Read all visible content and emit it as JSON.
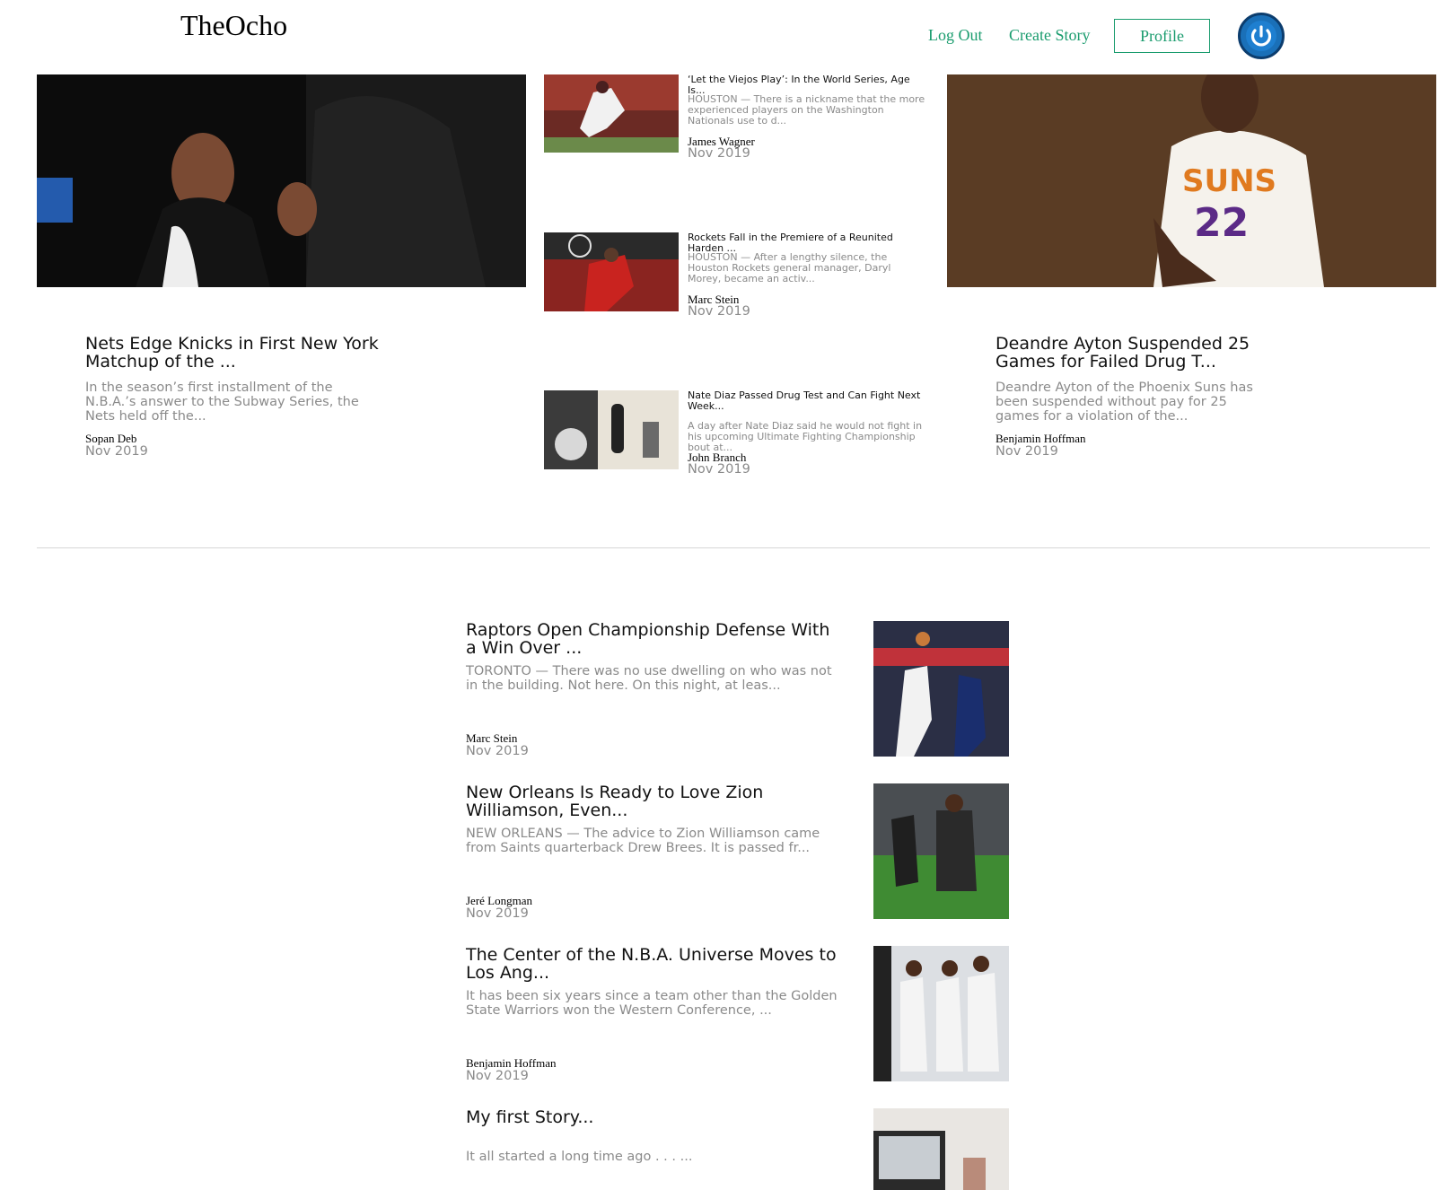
{
  "header": {
    "brand": "TheOcho",
    "logout": "Log Out",
    "create_story": "Create Story",
    "profile": "Profile",
    "accent_color": "#1a9c6e"
  },
  "featured": [
    {
      "title": "Nets Edge Knicks in First New York Matchup of the ...",
      "description": "In the season’s first installment of the N.B.A.’s answer to the Subway Series, the Nets held off the...",
      "author": "Sopan Deb",
      "date": "Nov 2019"
    },
    {
      "title": "Deandre Ayton Suspended 25 Games for Failed Drug T...",
      "description": "Deandre Ayton of the Phoenix Suns has been suspended without pay for 25 games for a violation of the...",
      "author": "Benjamin Hoffman",
      "date": "Nov 2019"
    }
  ],
  "middle": [
    {
      "title": "‘Let the Viejos Play’: In the World Series, Age Is...",
      "description": "HOUSTON — There is a nickname that the more experienced players on the Washington Nationals use to d...",
      "author": "James Wagner",
      "date": "Nov 2019"
    },
    {
      "title": "Rockets Fall in the Premiere of a Reunited Harden ...",
      "description": "HOUSTON — After a lengthy silence, the Houston Rockets general manager, Daryl Morey, became an activ...",
      "author": "Marc Stein",
      "date": "Nov 2019"
    },
    {
      "title": "Nate Diaz Passed Drug Test and Can Fight Next Week...",
      "description": "A day after Nate Diaz said he would not fight in his upcoming Ultimate Fighting Championship bout at...",
      "author": "John Branch",
      "date": "Nov 2019"
    }
  ],
  "list": [
    {
      "title": "Raptors Open Championship Defense With a Win Over ...",
      "description": "TORONTO — There was no use dwelling on who was not in the building. Not here. On this night, at leas...",
      "author": "Marc Stein",
      "date": "Nov 2019"
    },
    {
      "title": "New Orleans Is Ready to Love Zion Williamson, Even...",
      "description": "NEW ORLEANS — The advice to Zion Williamson came from Saints quarterback Drew Brees. It is passed fr...",
      "author": "Jeré Longman",
      "date": "Nov 2019"
    },
    {
      "title": "The Center of the N.B.A. Universe Moves to Los Ang...",
      "description": "It has been six years since a team other than the Golden State Warriors won the Western Conference, ...",
      "author": "Benjamin Hoffman",
      "date": "Nov 2019"
    },
    {
      "title": "My first Story...",
      "description": "It all started a long time ago . . . ...",
      "author": "",
      "date": ""
    }
  ]
}
